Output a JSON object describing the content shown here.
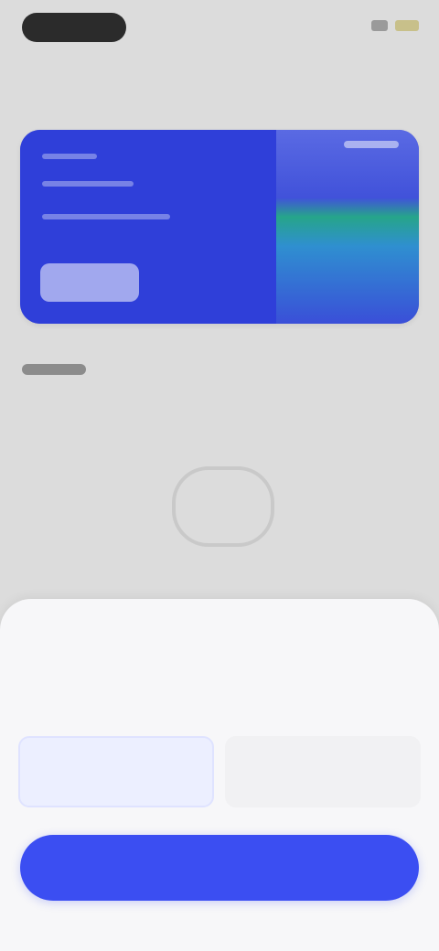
{
  "status_bar": {
    "time": "",
    "signal_icon": "signal-icon",
    "battery_icon": "battery-icon"
  },
  "card": {
    "brand_icon": "card-brand-icon"
  },
  "section": {
    "label": ""
  },
  "sheet": {
    "title": "",
    "options": [
      {
        "label": "",
        "selected": true
      },
      {
        "label": "",
        "selected": false
      }
    ],
    "cta_label": ""
  },
  "colors": {
    "primary": "#3b4ef2",
    "card_blue": "#2f3fd9"
  }
}
